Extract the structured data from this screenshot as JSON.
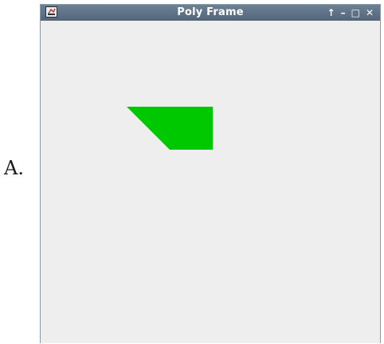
{
  "option_label": "A.",
  "window": {
    "title": "Poly Frame",
    "controls": {
      "pin_glyph": "↑",
      "minimize_glyph": "–",
      "maximize_glyph": "□",
      "close_glyph": "✕"
    }
  },
  "shape": {
    "fill": "#00c800",
    "icon": "green-trapezoid"
  }
}
